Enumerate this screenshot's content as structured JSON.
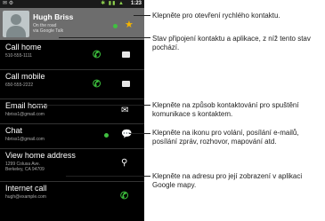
{
  "status_bar": {
    "time": "1:23",
    "left_icons": "✉ ⚙",
    "right_icons": "✱ ▮▮ ▲"
  },
  "contact": {
    "name": "Hugh Briss",
    "status_line1": "On the road",
    "status_line2": "via Google Talk"
  },
  "rows": [
    {
      "title": "Call home",
      "subtitle": "510-555-1111"
    },
    {
      "title": "Call mobile",
      "subtitle": "650-555-2222"
    },
    {
      "title": "Email home",
      "subtitle": "hbriss1@gmail.com"
    },
    {
      "title": "Chat",
      "subtitle": "hbriss1@gmail.com"
    },
    {
      "title": "View home address",
      "subtitle_line1": "1299 Colusa Ave.",
      "subtitle_line2": "Berkeley, CA 94709"
    },
    {
      "title": "Internet call",
      "subtitle": "hugh@example.com"
    }
  ],
  "callouts": [
    "Klepněte pro otevření rychlého kontaktu.",
    "Stav připojení kontaktu a aplikace, z níž tento stav pochází.",
    "Klepněte na způsob kontaktování pro spuštění komunikace s kontaktem.",
    "Klepněte na ikonu pro volání, posílání e-mailů, posílání zpráv, rozhovor, mapování atd.",
    "Klepněte na adresu pro její zobrazení v aplikaci Google mapy."
  ],
  "colors": {
    "presence_green": "#40c040",
    "star": "#f4b400",
    "phone_icon_green": "#3cbf3c"
  }
}
